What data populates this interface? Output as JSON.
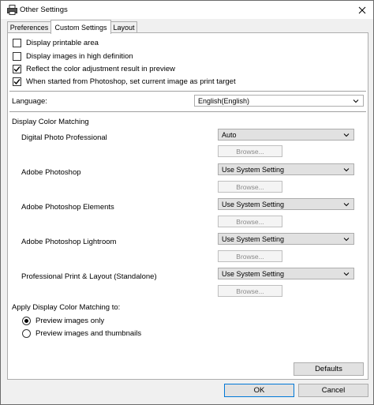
{
  "window": {
    "title": "Other Settings"
  },
  "tabs": [
    "Preferences",
    "Custom Settings",
    "Layout"
  ],
  "checkboxes": [
    {
      "label": "Display printable area",
      "checked": false
    },
    {
      "label": "Display images in high definition",
      "checked": false
    },
    {
      "label": "Reflect the color adjustment result in preview",
      "checked": true
    },
    {
      "label": "When started from Photoshop, set current image as print target",
      "checked": true
    }
  ],
  "language": {
    "label": "Language:",
    "value": "English(English)"
  },
  "color_matching": {
    "heading": "Display Color Matching",
    "apps": [
      {
        "label": "Digital Photo Professional",
        "value": "Auto",
        "browse": "Browse..."
      },
      {
        "label": "Adobe Photoshop",
        "value": "Use System Setting",
        "browse": "Browse..."
      },
      {
        "label": "Adobe Photoshop Elements",
        "value": "Use System Setting",
        "browse": "Browse..."
      },
      {
        "label": "Adobe Photoshop Lightroom",
        "value": "Use System Setting",
        "browse": "Browse..."
      },
      {
        "label": "Professional Print & Layout (Standalone)",
        "value": "Use System Setting",
        "browse": "Browse..."
      }
    ]
  },
  "apply_to": {
    "heading": "Apply Display Color Matching to:",
    "options": [
      {
        "label": "Preview images only",
        "selected": true
      },
      {
        "label": "Preview images and thumbnails",
        "selected": false
      }
    ]
  },
  "buttons": {
    "defaults": "Defaults",
    "ok": "OK",
    "cancel": "Cancel"
  },
  "colors": {
    "accent": "#0078d7",
    "panel": "#ffffff",
    "chrome": "#f0f0f0"
  }
}
